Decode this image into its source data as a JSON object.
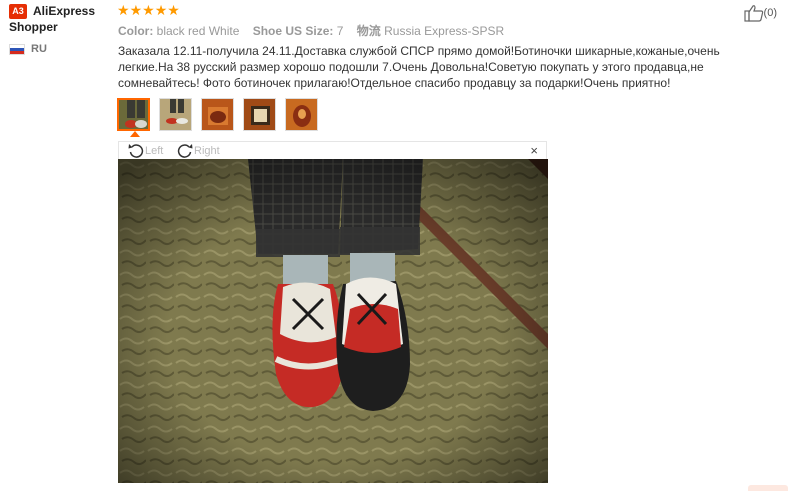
{
  "user": {
    "avatar_text": "A3",
    "name": "AliExpress Shopper",
    "country_code": "RU"
  },
  "rating": {
    "stars": 5,
    "max": 5
  },
  "meta": {
    "color_label": "Color:",
    "color_value": "black red White",
    "size_label": "Shoe US Size:",
    "size_value": "7",
    "shipping_label": "物流",
    "shipping_value": "Russia Express-SPSR"
  },
  "helpful": {
    "count": "(0)",
    "icon": "thumbs-up-icon"
  },
  "review": {
    "text": "Заказала 12.11-получила 24.11.Доставка службой СПСР прямо домой!Ботиночки шикарные,кожаные,очень легкие.На 38 русский размер хорошо подошли 7.Очень Довольна!Советую покупать у этого продавца,не сомневайтесь! Фото ботиночек прилагаю!Отдельное спасибо продавцу за подарки!Очень приятно!"
  },
  "viewer": {
    "rotate_left": "Left",
    "rotate_right": "Right",
    "close": "×"
  },
  "thumbnails": [
    {
      "active": true
    },
    {
      "active": false
    },
    {
      "active": false
    },
    {
      "active": false
    },
    {
      "active": false
    }
  ],
  "colors": {
    "star": "#ff9a00",
    "accent": "#ff6600",
    "badge": "#e62e04"
  }
}
